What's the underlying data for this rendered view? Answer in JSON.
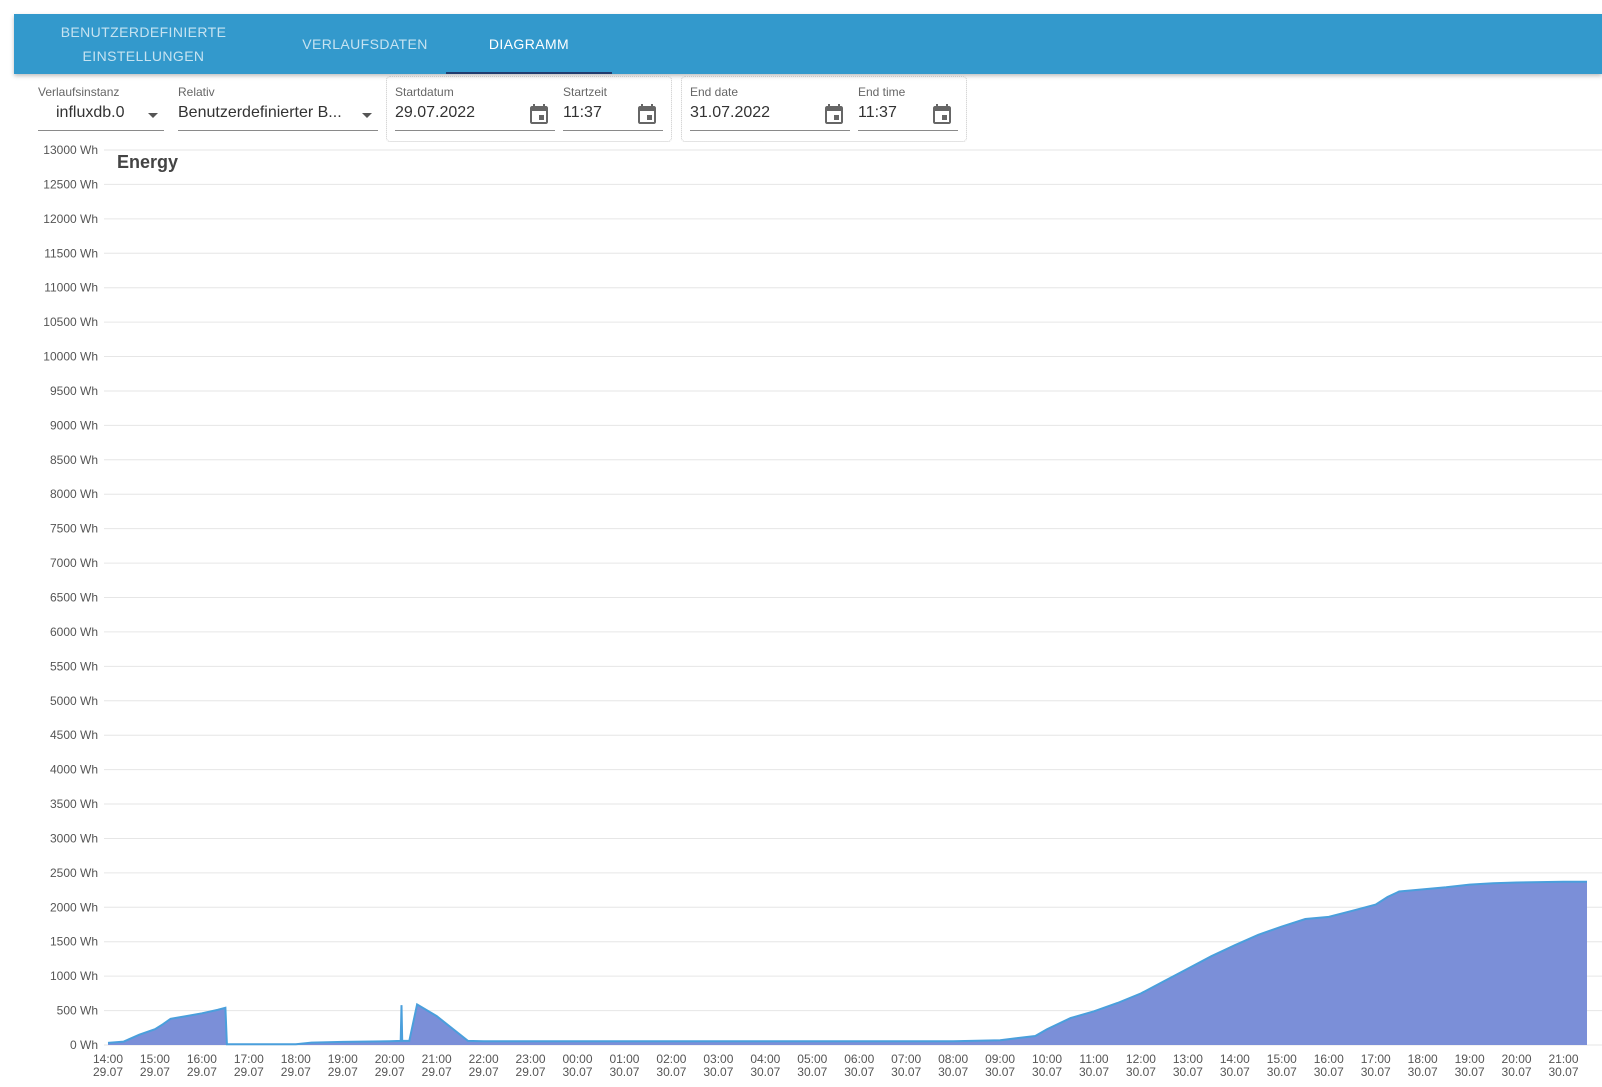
{
  "tabs": [
    {
      "label_line1": "BENUTZERDEFINIERTE",
      "label_line2": "EINSTELLUNGEN"
    },
    {
      "label": "VERLAUFSDATEN"
    },
    {
      "label": "DIAGRAMM",
      "active": true
    }
  ],
  "controls": {
    "instance": {
      "label": "Verlaufsinstanz",
      "value": "influxdb.0"
    },
    "relative": {
      "label": "Relativ",
      "value": "Benutzerdefinierter B..."
    },
    "start_date": {
      "label": "Startdatum",
      "value": "29.07.2022"
    },
    "start_time": {
      "label": "Startzeit",
      "value": "11:37"
    },
    "end_date": {
      "label": "End date",
      "value": "31.07.2022"
    },
    "end_time": {
      "label": "End time",
      "value": "11:37"
    }
  },
  "colors": {
    "tabbar": "#3399cc",
    "tab_indicator": "#1f3b6e",
    "area_fill": "#7b8fd8",
    "area_line": "#4a9fdc",
    "grid": "#e6e6e6"
  },
  "chart_data": {
    "type": "area",
    "title": "Energy",
    "unit": "Wh",
    "ylim": [
      0,
      13000
    ],
    "yticks": [
      0,
      500,
      1000,
      1500,
      2000,
      2500,
      3000,
      3500,
      4000,
      4500,
      5000,
      5500,
      6000,
      6500,
      7000,
      7500,
      8000,
      8500,
      9000,
      9500,
      10000,
      10500,
      11000,
      11500,
      12000,
      12500,
      13000
    ],
    "ytick_labels": [
      "0 Wh",
      "500 Wh",
      "1000 Wh",
      "1500 Wh",
      "2000 Wh",
      "2500 Wh",
      "3000 Wh",
      "3500 Wh",
      "4000 Wh",
      "4500 Wh",
      "5000 Wh",
      "5500 Wh",
      "6000 Wh",
      "6500 Wh",
      "7000 Wh",
      "7500 Wh",
      "8000 Wh",
      "8500 Wh",
      "9000 Wh",
      "9500 Wh",
      "10000 Wh",
      "10500 Wh",
      "11000 Wh",
      "11500 Wh",
      "12000 Wh",
      "12500 Wh",
      "13000 Wh"
    ],
    "grid": true,
    "xlim": [
      "29.07 14:00",
      "30.07 21:30"
    ],
    "x_ticks": [
      {
        "time": "14:00",
        "date": "29.07"
      },
      {
        "time": "15:00",
        "date": "29.07"
      },
      {
        "time": "16:00",
        "date": "29.07"
      },
      {
        "time": "17:00",
        "date": "29.07"
      },
      {
        "time": "18:00",
        "date": "29.07"
      },
      {
        "time": "19:00",
        "date": "29.07"
      },
      {
        "time": "20:00",
        "date": "29.07"
      },
      {
        "time": "21:00",
        "date": "29.07"
      },
      {
        "time": "22:00",
        "date": "29.07"
      },
      {
        "time": "23:00",
        "date": "29.07"
      },
      {
        "time": "00:00",
        "date": "30.07"
      },
      {
        "time": "01:00",
        "date": "30.07"
      },
      {
        "time": "02:00",
        "date": "30.07"
      },
      {
        "time": "03:00",
        "date": "30.07"
      },
      {
        "time": "04:00",
        "date": "30.07"
      },
      {
        "time": "05:00",
        "date": "30.07"
      },
      {
        "time": "06:00",
        "date": "30.07"
      },
      {
        "time": "07:00",
        "date": "30.07"
      },
      {
        "time": "08:00",
        "date": "30.07"
      },
      {
        "time": "09:00",
        "date": "30.07"
      },
      {
        "time": "10:00",
        "date": "30.07"
      },
      {
        "time": "11:00",
        "date": "30.07"
      },
      {
        "time": "12:00",
        "date": "30.07"
      },
      {
        "time": "13:00",
        "date": "30.07"
      },
      {
        "time": "14:00",
        "date": "30.07"
      },
      {
        "time": "15:00",
        "date": "30.07"
      },
      {
        "time": "16:00",
        "date": "30.07"
      },
      {
        "time": "17:00",
        "date": "30.07"
      },
      {
        "time": "18:00",
        "date": "30.07"
      },
      {
        "time": "19:00",
        "date": "30.07"
      },
      {
        "time": "20:00",
        "date": "30.07"
      },
      {
        "time": "21:00",
        "date": "30.07"
      }
    ],
    "series": [
      {
        "points": [
          [
            "29.07 14:00",
            30
          ],
          [
            "29.07 14:20",
            50
          ],
          [
            "29.07 14:40",
            150
          ],
          [
            "29.07 15:00",
            230
          ],
          [
            "29.07 15:10",
            300
          ],
          [
            "29.07 15:20",
            380
          ],
          [
            "29.07 15:40",
            420
          ],
          [
            "29.07 16:00",
            460
          ],
          [
            "29.07 16:20",
            510
          ],
          [
            "29.07 16:30",
            540
          ],
          [
            "29.07 16:32",
            10
          ],
          [
            "29.07 17:00",
            10
          ],
          [
            "29.07 18:00",
            10
          ],
          [
            "29.07 18:20",
            35
          ],
          [
            "29.07 19:00",
            45
          ],
          [
            "29.07 20:00",
            55
          ],
          [
            "29.07 20:14",
            60
          ],
          [
            "29.07 20:15",
            580
          ],
          [
            "29.07 20:16",
            60
          ],
          [
            "29.07 20:25",
            60
          ],
          [
            "29.07 20:35",
            590
          ],
          [
            "29.07 21:00",
            420
          ],
          [
            "29.07 21:40",
            60
          ],
          [
            "29.07 22:00",
            55
          ],
          [
            "30.07 00:00",
            55
          ],
          [
            "30.07 04:00",
            55
          ],
          [
            "30.07 08:00",
            55
          ],
          [
            "30.07 09:00",
            70
          ],
          [
            "30.07 09:45",
            130
          ],
          [
            "30.07 10:00",
            230
          ],
          [
            "30.07 10:30",
            390
          ],
          [
            "30.07 11:00",
            490
          ],
          [
            "30.07 11:30",
            610
          ],
          [
            "30.07 12:00",
            750
          ],
          [
            "30.07 12:30",
            930
          ],
          [
            "30.07 13:00",
            1110
          ],
          [
            "30.07 13:30",
            1290
          ],
          [
            "30.07 14:00",
            1450
          ],
          [
            "30.07 14:30",
            1600
          ],
          [
            "30.07 15:00",
            1720
          ],
          [
            "30.07 15:30",
            1830
          ],
          [
            "30.07 16:00",
            1860
          ],
          [
            "30.07 16:30",
            1950
          ],
          [
            "30.07 17:00",
            2040
          ],
          [
            "30.07 17:15",
            2150
          ],
          [
            "30.07 17:30",
            2230
          ],
          [
            "30.07 18:00",
            2260
          ],
          [
            "30.07 18:30",
            2290
          ],
          [
            "30.07 19:00",
            2330
          ],
          [
            "30.07 19:30",
            2350
          ],
          [
            "30.07 20:00",
            2360
          ],
          [
            "30.07 21:00",
            2370
          ],
          [
            "30.07 21:30",
            2370
          ]
        ]
      }
    ]
  }
}
